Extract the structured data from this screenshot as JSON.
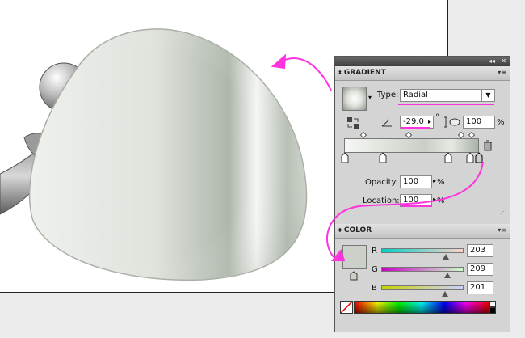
{
  "gradient_panel": {
    "tab_label": "GRADIENT",
    "type_label": "Type:",
    "type_value": "Radial",
    "angle_value": "-29.0",
    "angle_unit": "°",
    "aspect_value": "100",
    "aspect_unit": "%",
    "opacity_label": "Opacity:",
    "opacity_value": "100",
    "opacity_unit": "%",
    "location_label": "Location:",
    "location_value": "100",
    "location_unit": "%"
  },
  "color_panel": {
    "tab_label": "COLOR",
    "r_label": "R",
    "r_value": "203",
    "g_label": "G",
    "g_value": "209",
    "b_label": "B",
    "b_value": "201",
    "fill_color": "#cbd1c9"
  },
  "colors": {
    "annotation": "#ff33dd",
    "panel_bg": "#d4d4d4",
    "artboard": "#ffffff"
  },
  "icons": [
    "collapse-icon",
    "close-icon",
    "panel-menu-icon",
    "reverse-gradient-icon",
    "angle-icon",
    "aspect-ratio-icon",
    "trash-icon",
    "none-swatch-icon"
  ]
}
